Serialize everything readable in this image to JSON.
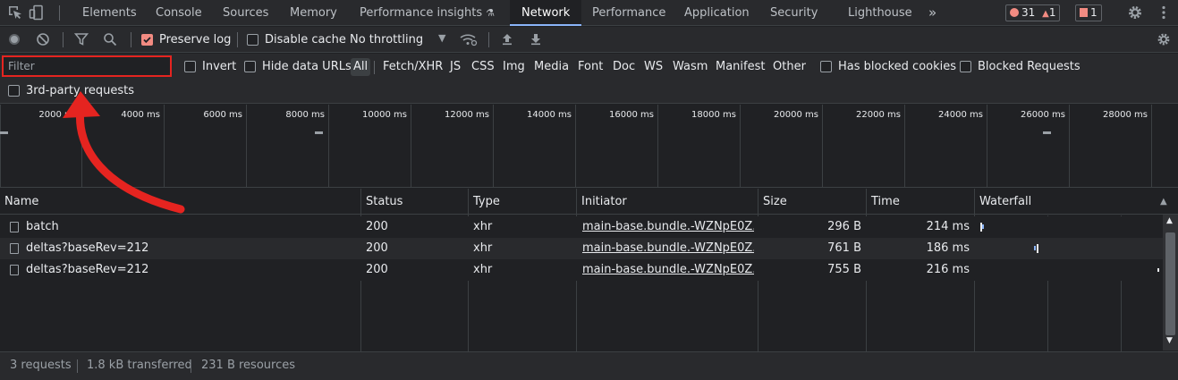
{
  "tabbar": {
    "tabs": [
      "Elements",
      "Console",
      "Sources",
      "Memory",
      "Performance insights",
      "Network",
      "Performance",
      "Application",
      "Security",
      "Lighthouse"
    ],
    "more_label": "»",
    "errors_count": "31",
    "warnings_count": "1",
    "issues_count": "1"
  },
  "toolbar": {
    "preserve_log_label": "Preserve log",
    "disable_cache_label": "Disable cache",
    "throttling_label": "No throttling"
  },
  "filterbar": {
    "filter_placeholder": "Filter",
    "invert_label": "Invert",
    "hide_data_urls_label": "Hide data URLs",
    "types": [
      "All",
      "Fetch/XHR",
      "JS",
      "CSS",
      "Img",
      "Media",
      "Font",
      "Doc",
      "WS",
      "Wasm",
      "Manifest",
      "Other"
    ],
    "has_blocked_cookies_label": "Has blocked cookies",
    "blocked_requests_label": "Blocked Requests",
    "third_party_label": "3rd-party requests"
  },
  "overview": {
    "ticks": [
      "2000 ms",
      "4000 ms",
      "6000 ms",
      "8000 ms",
      "10000 ms",
      "12000 ms",
      "14000 ms",
      "16000 ms",
      "18000 ms",
      "20000 ms",
      "22000 ms",
      "24000 ms",
      "26000 ms",
      "28000 ms"
    ]
  },
  "table": {
    "headers": [
      "Name",
      "Status",
      "Type",
      "Initiator",
      "Size",
      "Time",
      "Waterfall"
    ],
    "rows": [
      {
        "name": "batch",
        "status": "200",
        "type": "xhr",
        "initiator": "main-base.bundle.-WZNpE0Z...",
        "size": "296 B",
        "time": "214 ms"
      },
      {
        "name": "deltas?baseRev=212",
        "status": "200",
        "type": "xhr",
        "initiator": "main-base.bundle.-WZNpE0Z...",
        "size": "761 B",
        "time": "186 ms"
      },
      {
        "name": "deltas?baseRev=212",
        "status": "200",
        "type": "xhr",
        "initiator": "main-base.bundle.-WZNpE0Z...",
        "size": "755 B",
        "time": "216 ms"
      }
    ]
  },
  "statusbar": {
    "requests": "3 requests",
    "transferred": "1.8 kB transferred",
    "resources": "231 B resources"
  },
  "colors": {
    "highlight_red": "#e52420",
    "accent_blue": "#8ab4f8",
    "background": "#202124"
  }
}
